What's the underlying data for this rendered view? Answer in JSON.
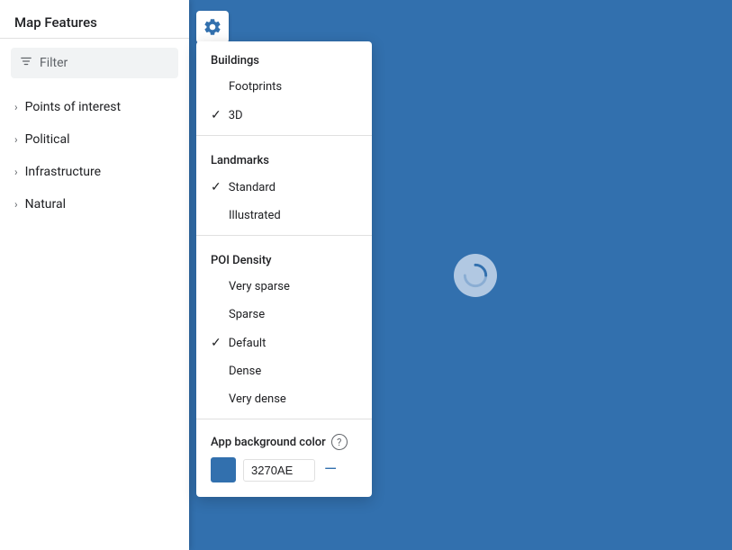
{
  "app": {
    "title": "Map Features"
  },
  "sidebar": {
    "title": "Map Features",
    "filter_placeholder": "Filter",
    "nav_items": [
      {
        "label": "Points of interest"
      },
      {
        "label": "Political"
      },
      {
        "label": "Infrastructure"
      },
      {
        "label": "Natural"
      }
    ]
  },
  "dropdown": {
    "sections": [
      {
        "label": "Buildings",
        "items": [
          {
            "label": "Footprints",
            "checked": false
          },
          {
            "label": "3D",
            "checked": true
          }
        ]
      },
      {
        "label": "Landmarks",
        "items": [
          {
            "label": "Standard",
            "checked": true
          },
          {
            "label": "Illustrated",
            "checked": false
          }
        ]
      },
      {
        "label": "POI Density",
        "items": [
          {
            "label": "Very sparse",
            "checked": false
          },
          {
            "label": "Sparse",
            "checked": false
          },
          {
            "label": "Default",
            "checked": true
          },
          {
            "label": "Dense",
            "checked": false
          },
          {
            "label": "Very dense",
            "checked": false
          }
        ]
      }
    ],
    "bg_color": {
      "label": "App background color",
      "value": "3270AE",
      "swatch_color": "#3270ae"
    }
  },
  "spinner": "C",
  "icons": {
    "gear": "gear-icon",
    "filter": "filter-icon",
    "chevron": "chevron-right-icon",
    "help": "?",
    "check": "✓",
    "clear": "—"
  }
}
